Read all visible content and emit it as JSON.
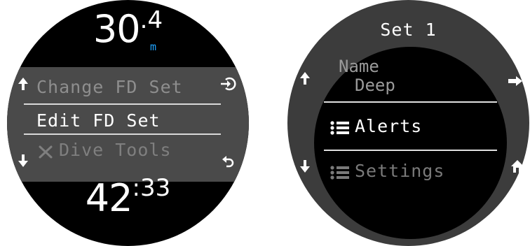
{
  "left_screen": {
    "depth": {
      "whole": "30",
      "decimal_sep": ".",
      "fraction": "4",
      "unit": "m"
    },
    "menu": {
      "items": [
        {
          "label": "Change FD Set",
          "state": "dimmed"
        },
        {
          "label": "Edit FD Set",
          "state": "selected"
        },
        {
          "label": "Dive Tools",
          "state": "dimmed",
          "icon": "tools-icon"
        }
      ]
    },
    "time": {
      "hours": "42",
      "separator": ":",
      "minutes": "33"
    },
    "buttons": {
      "top_left": "arrow-up-icon",
      "bottom_left": "arrow-down-icon",
      "top_right": "enter-icon",
      "bottom_right": "back-icon"
    }
  },
  "right_screen": {
    "title": "Set 1",
    "name": {
      "label": "Name",
      "value": "Deep"
    },
    "items": [
      {
        "label": "Alerts",
        "state": "selected",
        "icon": "list-icon"
      },
      {
        "label": "Settings",
        "state": "dimmed",
        "icon": "list-icon"
      }
    ],
    "buttons": {
      "top_left": "arrow-up-icon",
      "bottom_left": "arrow-down-icon",
      "top_right": "arrow-right-icon",
      "bottom_right": "home-icon"
    }
  },
  "colors": {
    "accent_unit": "#1fa3ff",
    "menu_band": "#4a4a4a",
    "bezel": "#3c3c3c",
    "dimmed_text": "#8e8e8e"
  }
}
